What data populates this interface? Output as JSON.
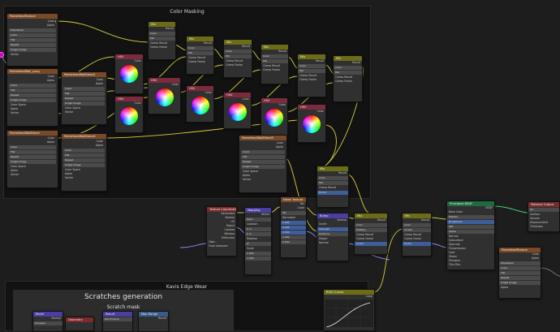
{
  "frames": {
    "color_masking": "Color Masking",
    "kavis_edge_wear": "Kavis Edge Wear",
    "scratches_generation": "Scratches generation",
    "scratch_mask": "Scratch mask"
  },
  "image_texture": {
    "color": "Color",
    "alpha": "Alpha",
    "image": "PolesHead",
    "interpolation": "Cubic",
    "projection": "Flat",
    "extension": "Repeat",
    "source": "Single Image",
    "color_space": "Color Space",
    "color_space_value": "sRGB",
    "alpha_mode": "Alpha",
    "alpha_value": "Straight",
    "vector": "Vector"
  },
  "image_texture_images": [
    "PolesHeadTexture",
    "PolesHeadWall_Long",
    "PolesHeadWallBlend",
    "PolesHeadWallBlend1",
    "PolesHeadWallBlend2",
    "PolesHeadWallBlend3"
  ],
  "mix": {
    "title": "Mix",
    "result": "Result",
    "color": "Color",
    "mix": "Mix",
    "clamp_result": "Clamp Result",
    "clamp_factor": "Clamp Factor",
    "factor": "Factor",
    "a": "A",
    "b": "B",
    "multiply": "Multiply",
    "screen": "Screen"
  },
  "hsv": {
    "title": "HSV",
    "color": "Color"
  },
  "texcoord": {
    "title": "Texture Coordinate",
    "outputs": [
      "Generated",
      "Normal",
      "UV",
      "Object",
      "Camera",
      "Window",
      "Reflection"
    ],
    "object": "Obje...",
    "from_instancer": "From Instancer"
  },
  "mapping": {
    "title": "Mapping",
    "vector": "Vector",
    "type": "Type",
    "type_value": "Point",
    "location": "Location",
    "rotation": "Rotation",
    "scale": "Scale",
    "x": "X",
    "y": "Y",
    "z": "Z",
    "loc_vals": [
      "0 m",
      "0 m",
      "0 m"
    ],
    "rot_vals": [
      "0°",
      "0°",
      "0°"
    ],
    "scale_vals": [
      "1.000",
      "1.000",
      "1.000"
    ]
  },
  "noise": {
    "title": "Noise Texture",
    "fac": "Fac",
    "color": "Color",
    "dims": "3D",
    "normalize": "Normalize",
    "vector": "Vector",
    "fields": [
      "Scale",
      "Detail",
      "Roughness",
      "Lacunarity",
      "Distortion"
    ],
    "values": [
      "5.000",
      "2.000",
      "0.500",
      "2.000",
      "0.000"
    ]
  },
  "ramp": {
    "title": "Color Ramp",
    "color": "Color",
    "alpha": "Alpha",
    "interp": "Linear",
    "pos": "Pos",
    "fac": "Fac"
  },
  "bump": {
    "title": "Bump",
    "normal": "Normal",
    "invert": "Invert",
    "strength": "Strength",
    "distance": "Distance",
    "height": "Height"
  },
  "bsdf": {
    "title": "Principled BSDF",
    "bsdf": "BSDF",
    "base_color": "Base Color",
    "fields": [
      "Metallic",
      "Roughness",
      "IOR",
      "Alpha",
      "Normal",
      "Subsurface",
      "Specular",
      "Transmission",
      "Coat",
      "Sheen",
      "Emission",
      "Thin Film"
    ],
    "values": [
      "0.000",
      "0.500",
      "1.450",
      "1.000",
      "",
      "",
      "",
      "",
      "",
      "",
      "",
      ""
    ]
  },
  "output": {
    "title": "Material Output",
    "all": "All",
    "inputs": [
      "Surface",
      "Volume",
      "Displacement",
      "Thickness"
    ]
  },
  "curves": {
    "title": "RGB Curves",
    "color": "Color",
    "fac": "Fac"
  },
  "bottom_nodes": {
    "bevel": "Bevel",
    "normal": "Normal",
    "geometry": "Geometry",
    "map_range": "Map Range",
    "dot_product": "Dot Product",
    "samples": "Samples",
    "result": "Result"
  }
}
